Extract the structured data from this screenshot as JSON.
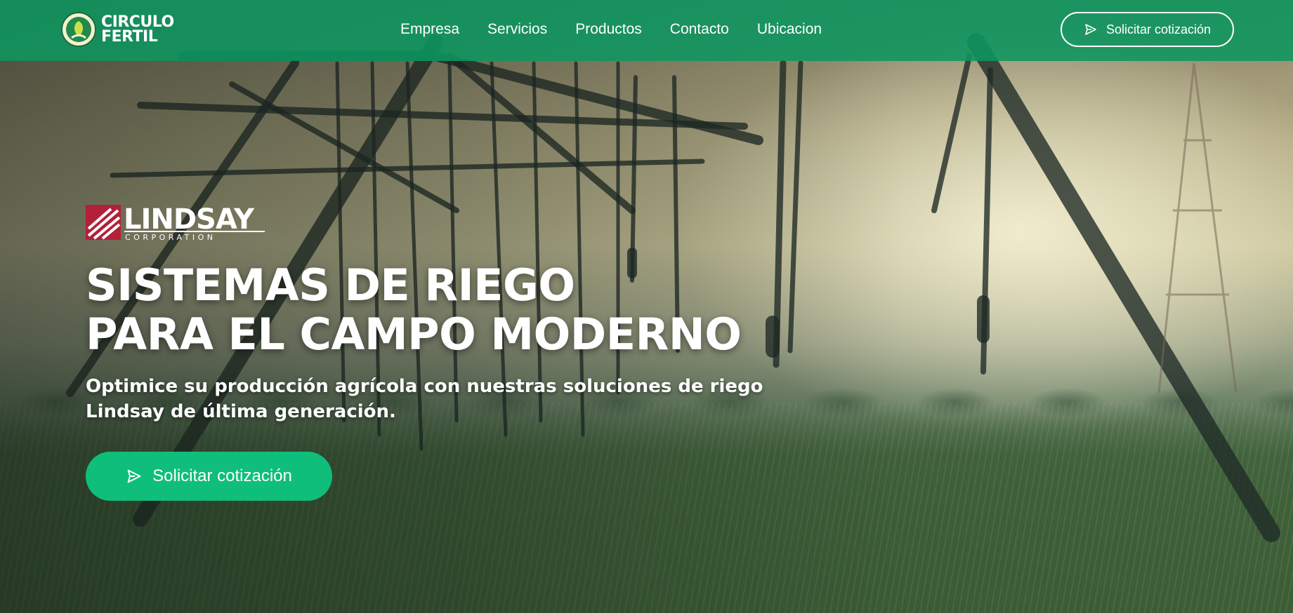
{
  "header": {
    "brand_line1": "CIRCULO",
    "brand_line2": "FERTIL",
    "nav": [
      "Empresa",
      "Servicios",
      "Productos",
      "Contacto",
      "Ubicacion"
    ],
    "cta_label": "Solicitar cotización"
  },
  "hero": {
    "partner_logo_name": "LINDSAY",
    "partner_logo_sub": "CORPORATION",
    "headline_line1": "SISTEMAS DE RIEGO",
    "headline_line2": "PARA EL CAMPO MODERNO",
    "subtitle_line1": "Optimice su producción agrícola con nuestras soluciones de riego",
    "subtitle_line2": "Lindsay de última generación.",
    "cta_label": "Solicitar cotización"
  },
  "colors": {
    "header_bg": "#0c9660",
    "cta_bg": "#0fbe7a",
    "lindsay_red": "#b3203a"
  },
  "icons": {
    "send": "send-icon",
    "brand": "circulo-fertil-logo"
  }
}
